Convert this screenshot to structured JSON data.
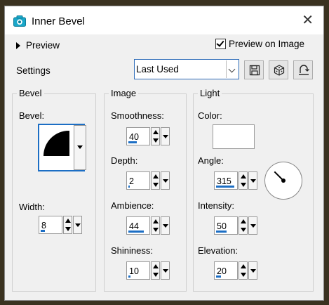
{
  "window": {
    "title": "Inner Bevel",
    "close_glyph": "✕"
  },
  "preview": {
    "label": "Preview",
    "preview_on_image_label": "Preview on Image",
    "preview_on_image_checked": true
  },
  "settings": {
    "label": "Settings",
    "preset_value": "Last Used"
  },
  "toolbar_icons": [
    "save-icon",
    "randomize-dice-icon",
    "reset-icon"
  ],
  "bevel_group": {
    "title": "Bevel",
    "bevel_label": "Bevel:",
    "width_label": "Width:",
    "width_value": "8",
    "width_fill": 0.2
  },
  "image_group": {
    "title": "Image",
    "smoothness_label": "Smoothness:",
    "smoothness_value": "40",
    "smoothness_fill": 0.4,
    "depth_label": "Depth:",
    "depth_value": "2",
    "depth_fill": 0.05,
    "ambience_label": "Ambience:",
    "ambience_value": "44",
    "ambience_fill": 0.72,
    "shininess_label": "Shininess:",
    "shininess_value": "10",
    "shininess_fill": 0.1
  },
  "light_group": {
    "title": "Light",
    "color_label": "Color:",
    "color_value": "#ffffff",
    "angle_label": "Angle:",
    "angle_value": "315",
    "angle_fill": 0.875,
    "intensity_label": "Intensity:",
    "intensity_value": "50",
    "intensity_fill": 0.5,
    "elevation_label": "Elevation:",
    "elevation_value": "20",
    "elevation_fill": 0.22
  },
  "colors": {
    "accent": "#1c6ec4",
    "title_icon": "#1aa7c9"
  }
}
